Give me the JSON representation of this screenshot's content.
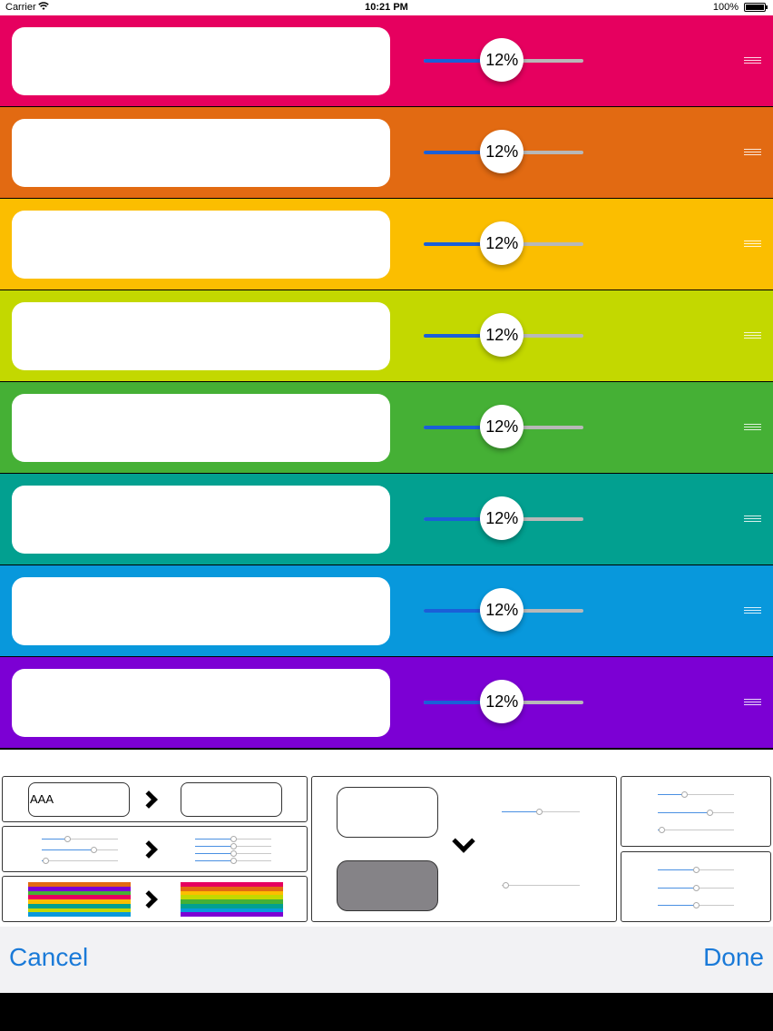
{
  "status_bar": {
    "carrier": "Carrier",
    "time": "10:21 PM",
    "battery": "100%"
  },
  "rows": [
    {
      "color": "#e6005f",
      "value_label": "12%",
      "value": 12,
      "text": ""
    },
    {
      "color": "#e26a12",
      "value_label": "12%",
      "value": 12,
      "text": ""
    },
    {
      "color": "#fbbe00",
      "value_label": "12%",
      "value": 12,
      "text": ""
    },
    {
      "color": "#c3d800",
      "value_label": "12%",
      "value": 12,
      "text": ""
    },
    {
      "color": "#45b035",
      "value_label": "12%",
      "value": 12,
      "text": ""
    },
    {
      "color": "#02a090",
      "value_label": "12%",
      "value": 12,
      "text": ""
    },
    {
      "color": "#0898dc",
      "value_label": "12%",
      "value": 12,
      "text": ""
    },
    {
      "color": "#7c00d4",
      "value_label": "12%",
      "value": 12,
      "text": ""
    }
  ],
  "options_panel": {
    "text_option_sample": "AAA"
  },
  "toolbar": {
    "cancel_label": "Cancel",
    "done_label": "Done"
  },
  "colors": {
    "accent": "#1a7ad8",
    "slider_fill": "#1a5fd8"
  }
}
